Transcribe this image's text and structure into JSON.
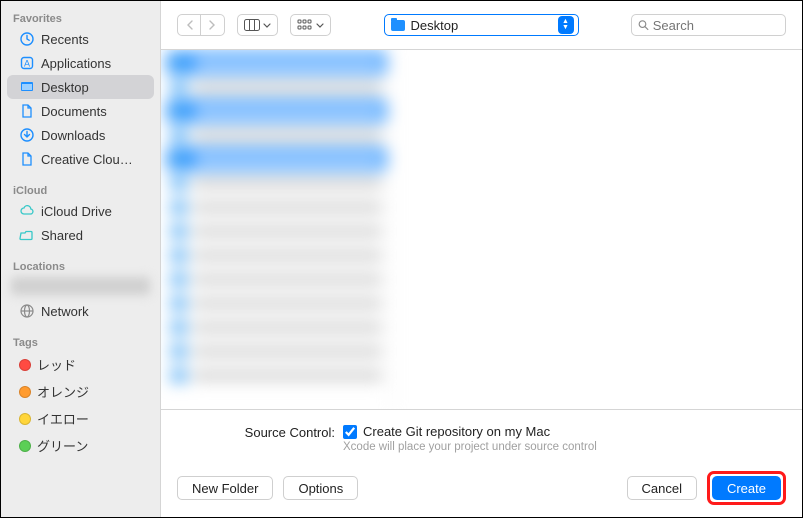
{
  "sidebar": {
    "sections": [
      {
        "header": "Favorites",
        "items": [
          {
            "label": "Recents",
            "icon": "clock"
          },
          {
            "label": "Applications",
            "icon": "app"
          },
          {
            "label": "Desktop",
            "icon": "desktop",
            "selected": true
          },
          {
            "label": "Documents",
            "icon": "doc"
          },
          {
            "label": "Downloads",
            "icon": "download"
          },
          {
            "label": "Creative Clou…",
            "icon": "doc"
          }
        ]
      },
      {
        "header": "iCloud",
        "items": [
          {
            "label": "iCloud Drive",
            "icon": "cloud"
          },
          {
            "label": "Shared",
            "icon": "shared"
          }
        ]
      },
      {
        "header": "Locations",
        "items": [
          {
            "label": "",
            "icon": "blurred"
          },
          {
            "label": "Network",
            "icon": "network"
          }
        ]
      },
      {
        "header": "Tags",
        "items": [
          {
            "label": "レッド",
            "color": "#ff4b42"
          },
          {
            "label": "オレンジ",
            "color": "#ff9b2f"
          },
          {
            "label": "イエロー",
            "color": "#ffd53a"
          },
          {
            "label": "グリーン",
            "color": "#5bcf56"
          }
        ]
      }
    ]
  },
  "toolbar": {
    "location": "Desktop",
    "search_placeholder": "Search"
  },
  "source_control": {
    "label": "Source Control:",
    "checkbox_label": "Create Git repository on my Mac",
    "checked": true,
    "hint": "Xcode will place your project under source control"
  },
  "buttons": {
    "new_folder": "New Folder",
    "options": "Options",
    "cancel": "Cancel",
    "create": "Create"
  }
}
